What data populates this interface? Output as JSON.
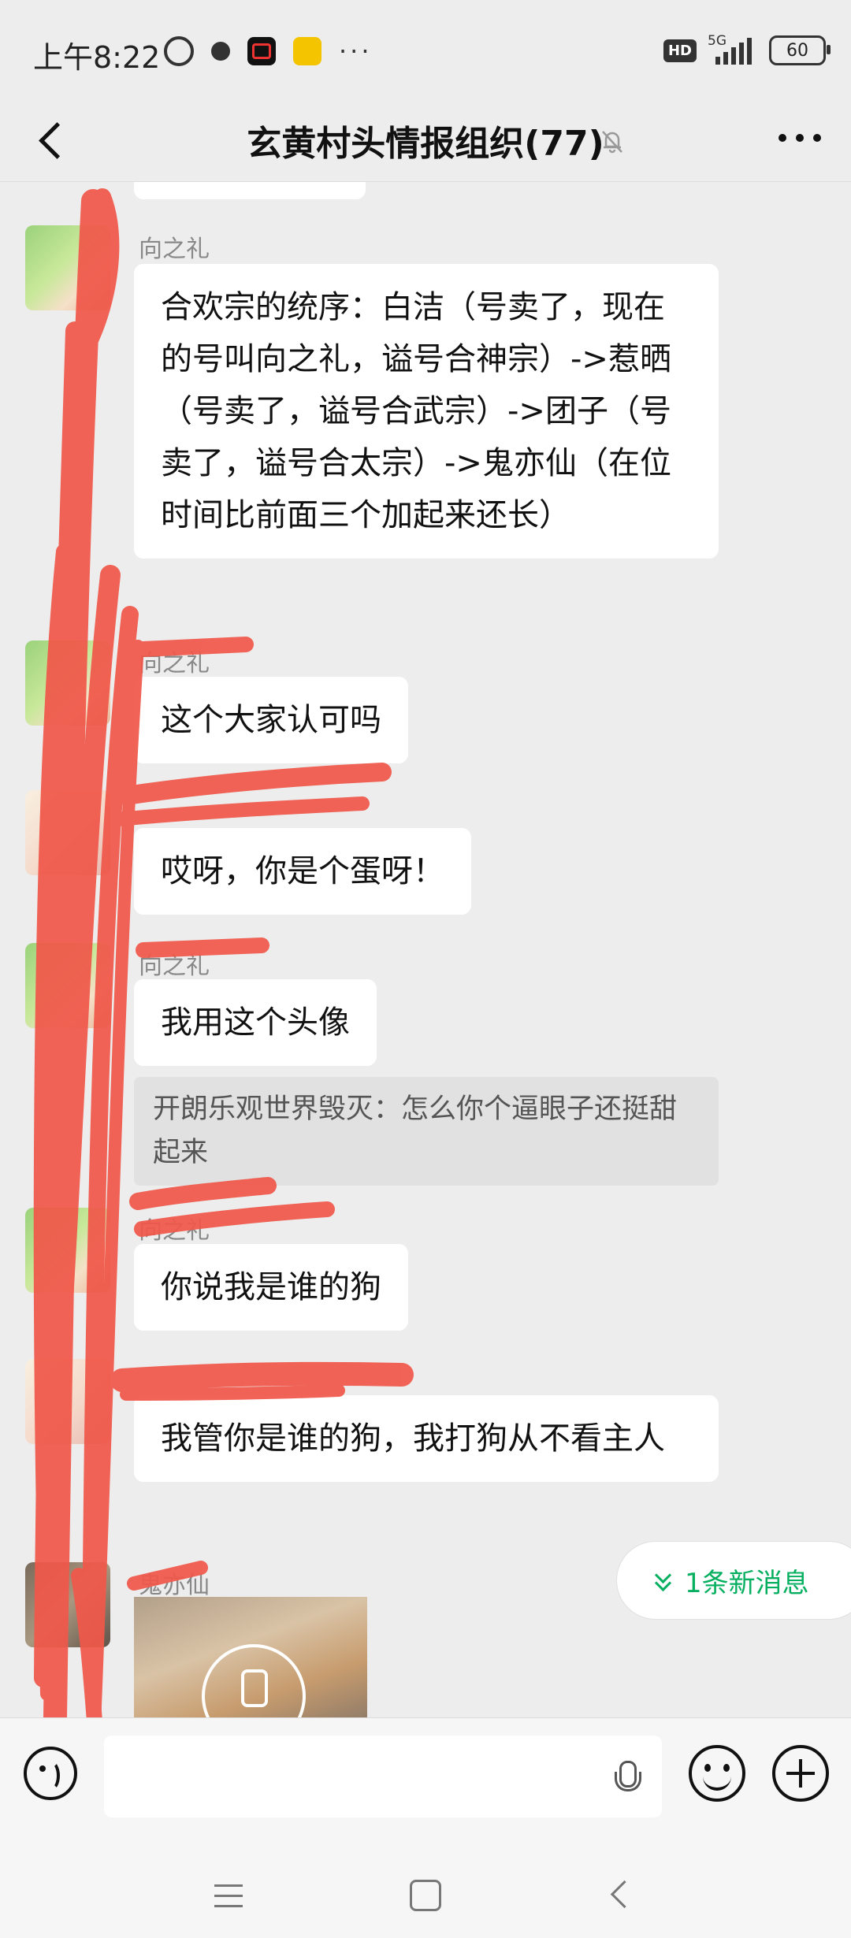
{
  "status_bar": {
    "time": "上午8:22",
    "more": "···",
    "hd": "HD",
    "network": "5G",
    "battery": "60"
  },
  "header": {
    "title": "玄黄村头情报组织(77)"
  },
  "messages": [
    {
      "sender": "向之礼",
      "text": "合欢宗的统序：白洁（号卖了，现在的号叫向之礼，谥号合神宗）->惹晒（号卖了，谥号合武宗）->团子（号卖了，谥号合太宗）->鬼亦仙（在位时间比前面三个加起来还长）"
    },
    {
      "sender": "向之礼",
      "text": "这个大家认可吗"
    },
    {
      "sender": "",
      "text": "哎呀，你是个蛋呀！"
    },
    {
      "sender": "向之礼",
      "text": "我用这个头像"
    },
    {
      "quote": "开朗乐观世界毁灭：怎么你个逼眼子还挺甜起来"
    },
    {
      "sender": "向之礼",
      "text": "你说我是谁的狗"
    },
    {
      "sender": "",
      "text": "我管你是谁的狗，我打狗从不看主人"
    },
    {
      "sender": "鬼亦仙",
      "type": "image"
    }
  ],
  "new_message_badge": "1条新消息",
  "colors": {
    "background": "#ededed",
    "bubble": "#ffffff",
    "accent": "#07b060",
    "scribble": "#f0584a"
  },
  "icons": {
    "back": "chevron-left-icon",
    "mute": "bell-off-icon",
    "more": "more-horizontal-icon",
    "voice": "voice-icon",
    "mic": "mic-icon",
    "emoji": "emoji-icon",
    "plus": "plus-icon"
  }
}
